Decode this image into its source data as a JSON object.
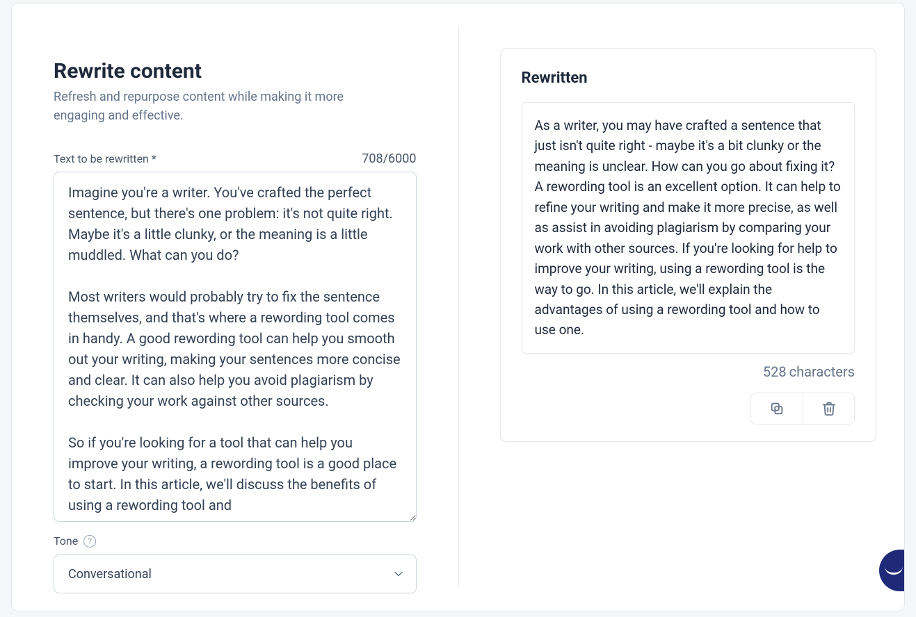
{
  "left": {
    "title": "Rewrite content",
    "subtitle": "Refresh and repurpose content while making it more engaging and effective.",
    "field_label": "Text to be rewritten *",
    "char_counter": "708/6000",
    "input_value": "Imagine you're a writer. You've crafted the perfect sentence, but there's one problem: it's not quite right. Maybe it's a little clunky, or the meaning is a little muddled. What can you do?\n\nMost writers would probably try to fix the sentence themselves, and that's where a rewording tool comes in handy. A good rewording tool can help you smooth out your writing, making your sentences more concise and clear. It can also help you avoid plagiarism by checking your work against other sources.\n\nSo if you're looking for a tool that can help you improve your writing, a rewording tool is a good place to start. In this article, we'll discuss the benefits of using a rewording tool and",
    "tone_label": "Tone",
    "tone_value": "Conversational"
  },
  "right": {
    "title": "Rewritten",
    "output_text": "As a writer, you may have crafted a sentence that just isn't quite right - maybe it's a bit clunky or the meaning is unclear. How can you go about fixing it? A rewording tool is an excellent option. It can help to refine your writing and make it more precise, as well as assist in avoiding plagiarism by comparing your work with other sources. If you're looking for help to improve your writing, using a rewording tool is the way to go. In this article, we'll explain the advantages of using a rewording tool and how to use one.",
    "char_count_value": "528",
    "char_count_label": "characters"
  }
}
